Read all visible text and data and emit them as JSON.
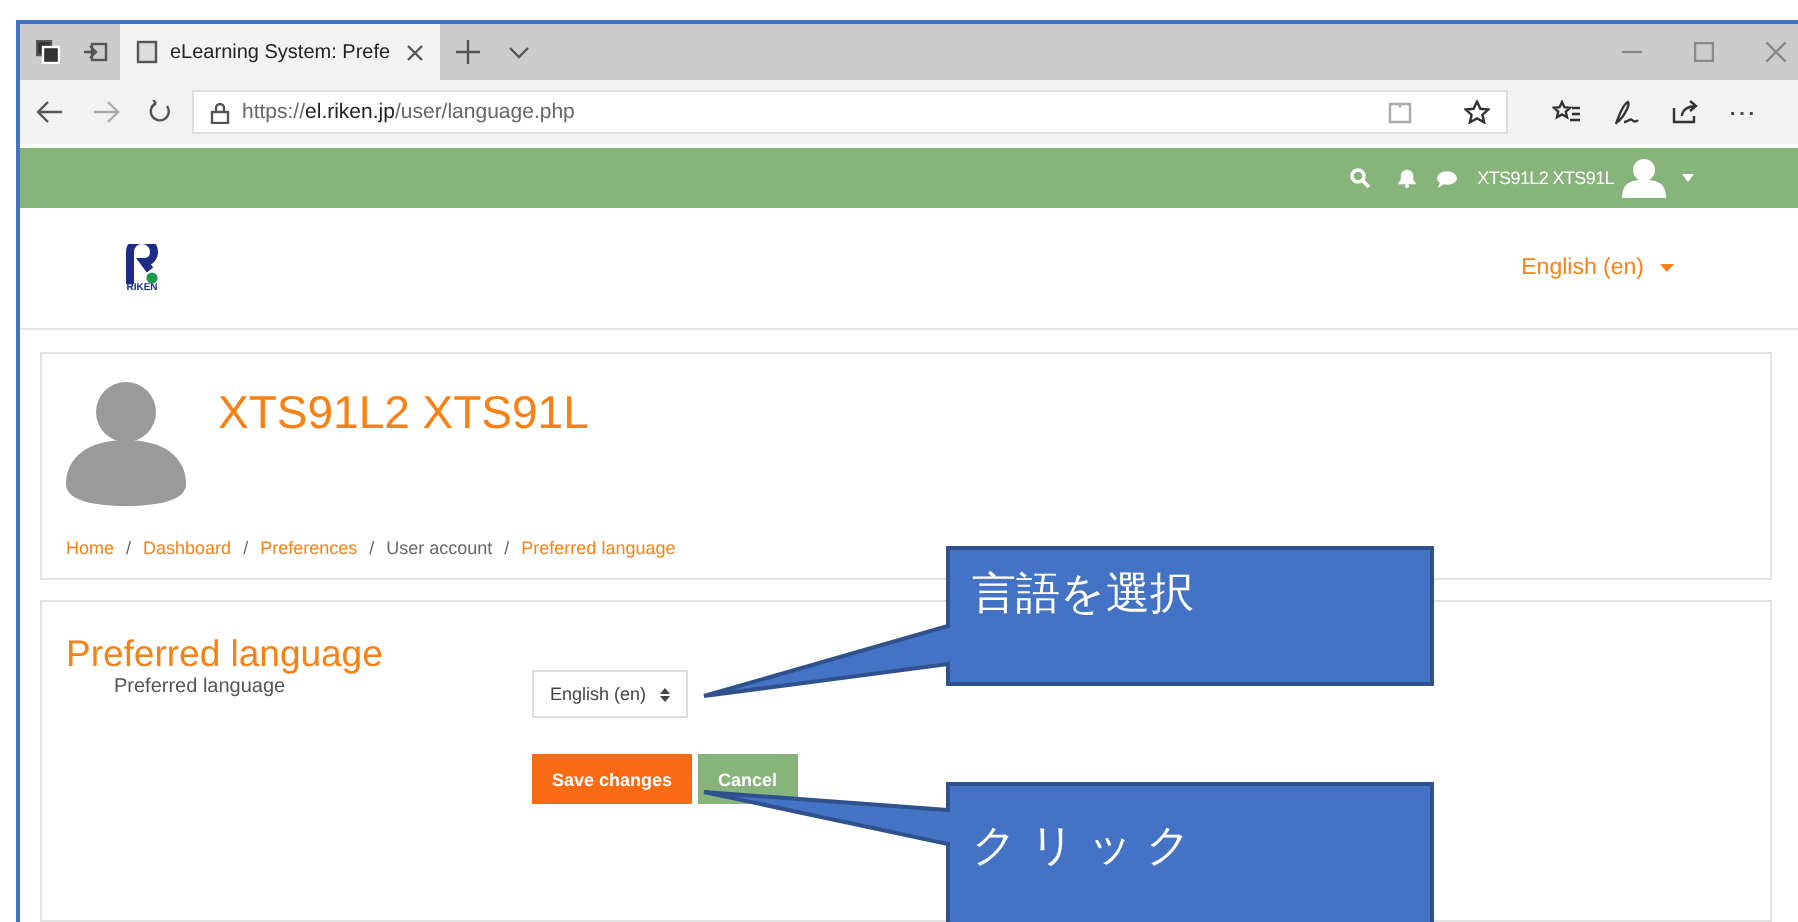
{
  "browser": {
    "tab_title": "eLearning System: Prefe",
    "url": {
      "scheme": "https://",
      "host": "el.riken.jp",
      "path": "/user/language.php"
    },
    "more_button": "⋯"
  },
  "navbar": {
    "user_name": "XTS91L2 XTS91L"
  },
  "header": {
    "logo_text": "RIKEN",
    "language_menu": "English (en)"
  },
  "profile": {
    "name": "XTS91L2 XTS91L",
    "breadcrumb_separators": [
      "/",
      "/",
      "/",
      "/"
    ],
    "breadcrumb": [
      {
        "label": "Home",
        "link": true
      },
      {
        "label": "Dashboard",
        "link": true
      },
      {
        "label": "Preferences",
        "link": true
      },
      {
        "label": "User account",
        "link": false
      },
      {
        "label": "Preferred language",
        "link": true
      }
    ]
  },
  "form": {
    "heading": "Preferred language",
    "field_label": "Preferred language",
    "select_value": "English (en)",
    "buttons": [
      {
        "label": "Save changes",
        "kind": "primary"
      },
      {
        "label": "Cancel",
        "kind": "secondary"
      }
    ]
  },
  "callouts": [
    {
      "text": "言語を選択"
    },
    {
      "text": "クリック"
    }
  ]
}
